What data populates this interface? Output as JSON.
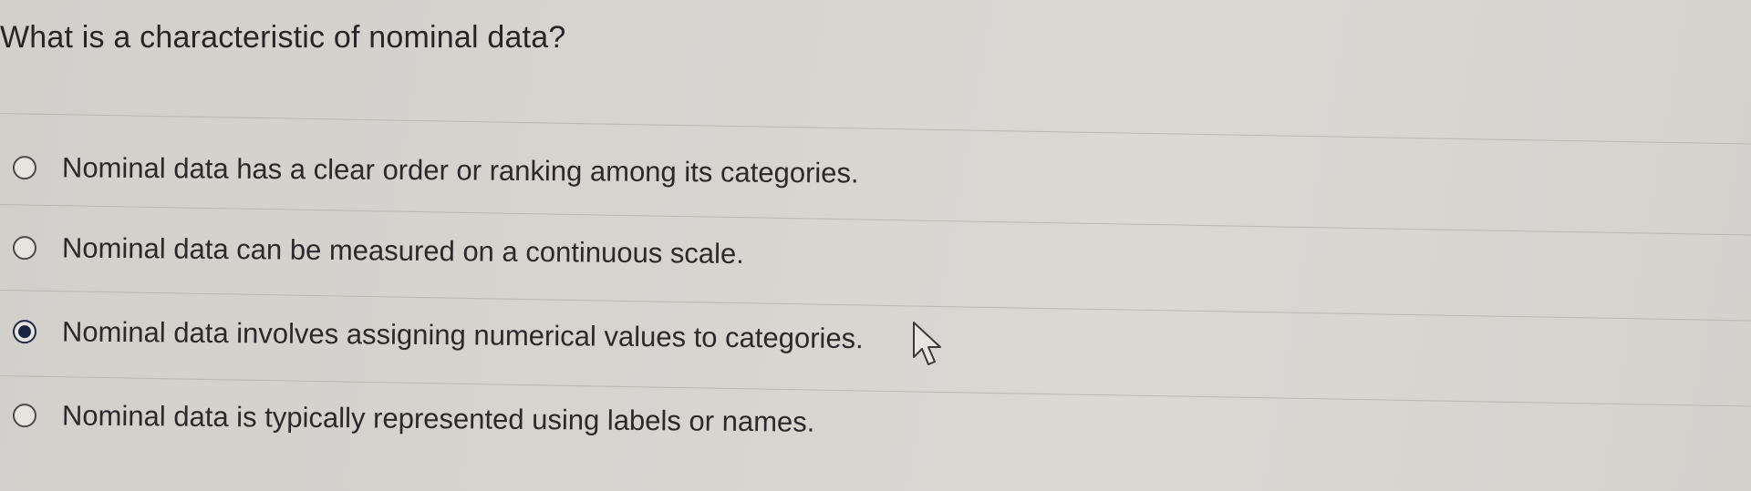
{
  "question": {
    "text": "What is a characteristic of nominal data?"
  },
  "options": [
    {
      "label": "Nominal data has a clear order or ranking among its categories.",
      "selected": false
    },
    {
      "label": "Nominal data can be measured on a continuous scale.",
      "selected": false
    },
    {
      "label": "Nominal data involves assigning numerical values to categories.",
      "selected": true
    },
    {
      "label": "Nominal data is typically represented using labels or names.",
      "selected": false
    }
  ],
  "cursor": {
    "icon": "arrow-cursor-icon"
  }
}
